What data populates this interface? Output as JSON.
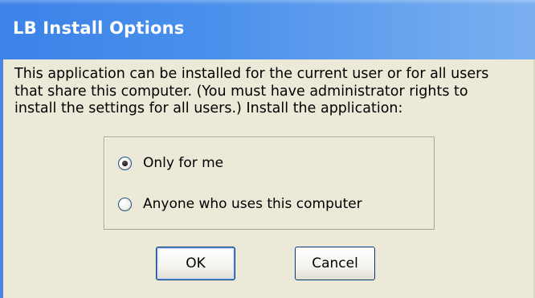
{
  "window": {
    "title": "LB Install Options"
  },
  "message": {
    "lines": [
      "This application can be installed for the current user or for all users",
      "that share this computer.  (You must have administrator rights to",
      "install the settings for all users.) Install the application:"
    ]
  },
  "options": [
    {
      "label": "Only for me",
      "selected": true
    },
    {
      "label": "Anyone who uses this computer",
      "selected": false
    }
  ],
  "buttons": {
    "ok_label": "OK",
    "cancel_label": "Cancel"
  },
  "colors": {
    "titlebar_start": "#3c82e8",
    "titlebar_end": "#7bb0f0",
    "title_text": "#ffffff",
    "dialog_background": "#ece9d8",
    "button_border": "#003c74"
  }
}
